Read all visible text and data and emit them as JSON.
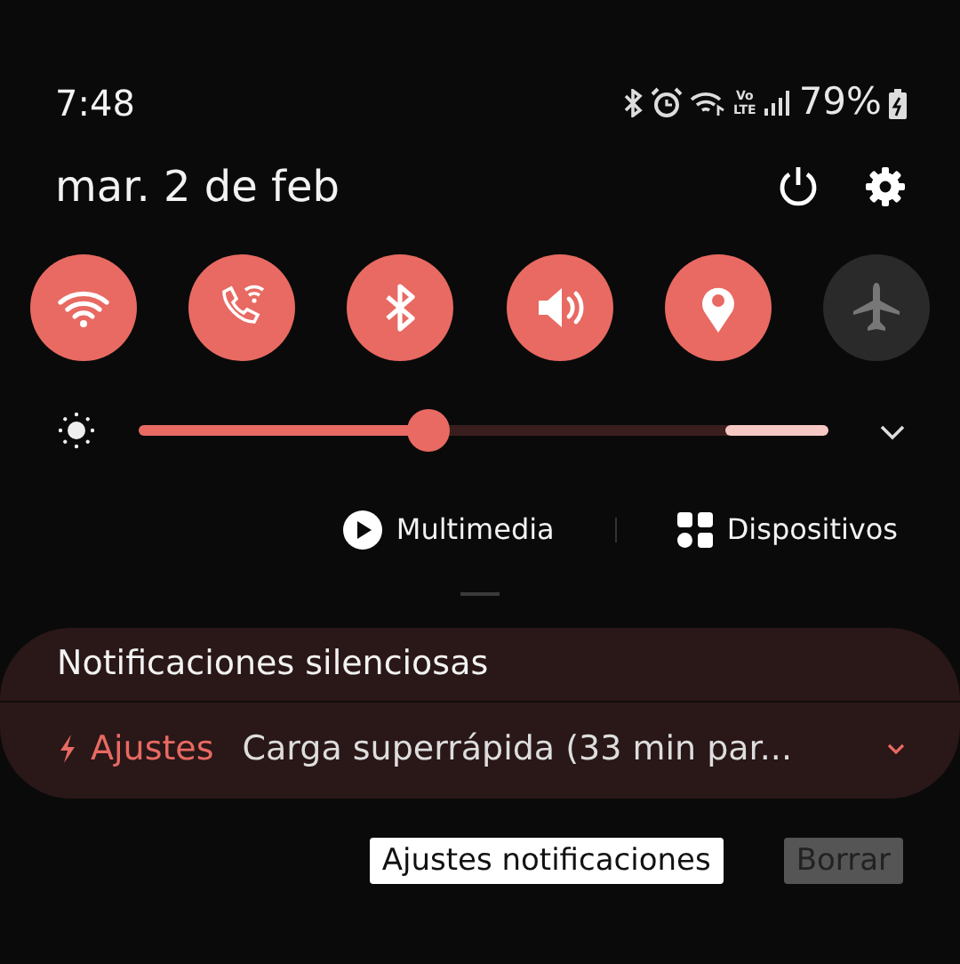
{
  "status_bar": {
    "time": "7:48",
    "volte_top": "Vo",
    "volte_bottom": "LTE",
    "battery": "79%"
  },
  "date": "mar. 2 de feb",
  "toggles": [
    {
      "kind": "wifi",
      "on": true
    },
    {
      "kind": "wifi-calling",
      "on": true
    },
    {
      "kind": "bluetooth",
      "on": true
    },
    {
      "kind": "sound",
      "on": true
    },
    {
      "kind": "location",
      "on": true
    },
    {
      "kind": "airplane",
      "on": false
    }
  ],
  "brightness": {
    "level": 0.42
  },
  "media_buttons": [
    {
      "kind": "play",
      "label": "Multimedia"
    },
    {
      "kind": "devices",
      "label": "Dispositivos"
    }
  ],
  "notifications": {
    "header": "Notificaciones silenciosas",
    "items": [
      {
        "app": "Ajustes",
        "text": "Carga superrápida (33 min par..."
      }
    ]
  },
  "actions": [
    {
      "label": "Ajustes notificaciones",
      "kind": "primary"
    },
    {
      "label": "Borrar",
      "kind": "muted"
    }
  ]
}
